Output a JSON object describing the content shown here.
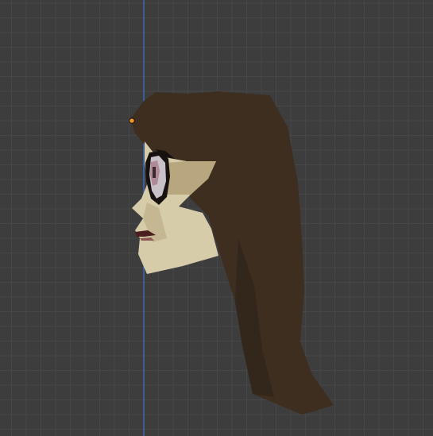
{
  "viewport": {
    "view": "side",
    "grid_visible": true,
    "background_color": "#3d3d3d",
    "grid_minor_color": "#474747",
    "grid_major_color": "#535353",
    "axis_color": "#3e74c9",
    "origin_marker_color": "#f2962e"
  },
  "model": {
    "parts": [
      "hair",
      "face",
      "eye",
      "mouth"
    ],
    "colors": {
      "hair": "#3e2e20",
      "hair_shadow": "#33261a",
      "skin": "#d6ccaa",
      "skin_shadow": "#b8a77e",
      "eye_white": "#c8c2c8",
      "eye_iris": "#b08a99",
      "eye_outline": "#171210",
      "mouth": "#4a1f1f"
    }
  }
}
